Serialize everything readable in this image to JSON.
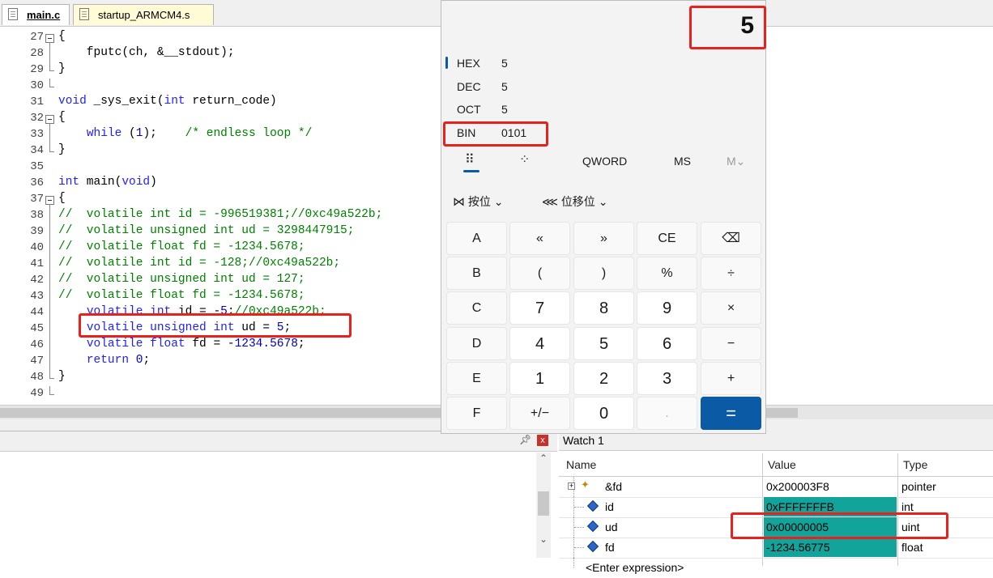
{
  "editor": {
    "tabs": [
      {
        "label": "main.c",
        "active": true
      },
      {
        "label": "startup_ARMCM4.s",
        "active": false
      }
    ],
    "lines": [
      {
        "n": "27",
        "t": "{",
        "parts": [
          [
            "",
            "{"
          ]
        ]
      },
      {
        "n": "28",
        "parts": [
          [
            "",
            "    fputc(ch, &__stdout);"
          ]
        ]
      },
      {
        "n": "29",
        "parts": [
          [
            "",
            "}"
          ]
        ]
      },
      {
        "n": "30",
        "parts": []
      },
      {
        "n": "31",
        "parts": [
          [
            "kw",
            "void"
          ],
          [
            "",
            " _sys_exit("
          ],
          [
            "kw",
            "int"
          ],
          [
            "",
            " return_code)"
          ]
        ]
      },
      {
        "n": "32",
        "parts": [
          [
            "",
            "{"
          ]
        ]
      },
      {
        "n": "33",
        "parts": [
          [
            "",
            "    "
          ],
          [
            "kw",
            "while"
          ],
          [
            "",
            " ("
          ],
          [
            "num",
            "1"
          ],
          [
            "",
            ");    "
          ],
          [
            "cm",
            "/* endless loop */"
          ]
        ]
      },
      {
        "n": "34",
        "parts": [
          [
            "",
            "}"
          ]
        ]
      },
      {
        "n": "35",
        "parts": []
      },
      {
        "n": "36",
        "parts": [
          [
            "kw",
            "int"
          ],
          [
            "",
            " main("
          ],
          [
            "kw",
            "void"
          ],
          [
            "",
            ")"
          ]
        ]
      },
      {
        "n": "37",
        "parts": [
          [
            "",
            "{"
          ]
        ]
      },
      {
        "n": "38",
        "parts": [
          [
            "cm",
            "//  volatile int id = -996519381;//0xc49a522b;"
          ]
        ]
      },
      {
        "n": "39",
        "parts": [
          [
            "cm",
            "//  volatile unsigned int ud = 3298447915;"
          ]
        ]
      },
      {
        "n": "40",
        "parts": [
          [
            "cm",
            "//  volatile float fd = -1234.5678;"
          ]
        ]
      },
      {
        "n": "41",
        "parts": [
          [
            "cm",
            "//  volatile int id = -128;//0xc49a522b;"
          ]
        ]
      },
      {
        "n": "42",
        "parts": [
          [
            "cm",
            "//  volatile unsigned int ud = 127;"
          ]
        ]
      },
      {
        "n": "43",
        "parts": [
          [
            "cm",
            "//  volatile float fd = -1234.5678;"
          ]
        ]
      },
      {
        "n": "44",
        "parts": [
          [
            "",
            "    "
          ],
          [
            "kw",
            "volatile"
          ],
          [
            "",
            " "
          ],
          [
            "kw",
            "int"
          ],
          [
            "",
            " id = -"
          ],
          [
            "num",
            "5"
          ],
          [
            "",
            ";"
          ],
          [
            "cm",
            "//0xc49a522b;"
          ]
        ]
      },
      {
        "n": "45",
        "parts": [
          [
            "",
            "    "
          ],
          [
            "kw",
            "volatile"
          ],
          [
            "",
            " "
          ],
          [
            "kw",
            "unsigned"
          ],
          [
            "",
            " "
          ],
          [
            "kw",
            "int"
          ],
          [
            "",
            " ud = "
          ],
          [
            "num",
            "5"
          ],
          [
            "",
            ";"
          ]
        ]
      },
      {
        "n": "46",
        "parts": [
          [
            "",
            "    "
          ],
          [
            "kw",
            "volatile"
          ],
          [
            "",
            " "
          ],
          [
            "kw",
            "float"
          ],
          [
            "",
            " fd = -"
          ],
          [
            "num",
            "1234.5678"
          ],
          [
            "",
            ";"
          ]
        ]
      },
      {
        "n": "47",
        "parts": [
          [
            "",
            "    "
          ],
          [
            "kw",
            "return"
          ],
          [
            "",
            " "
          ],
          [
            "num",
            "0"
          ],
          [
            "",
            ";"
          ]
        ]
      },
      {
        "n": "48",
        "parts": [
          [
            "",
            "}"
          ]
        ]
      },
      {
        "n": "49",
        "parts": []
      }
    ]
  },
  "calculator": {
    "display": "5",
    "radix": [
      {
        "label": "HEX",
        "value": "5"
      },
      {
        "label": "DEC",
        "value": "5"
      },
      {
        "label": "OCT",
        "value": "5"
      },
      {
        "label": "BIN",
        "value": "0101"
      }
    ],
    "keypad_icon": "⠿",
    "bitpad_icon": "⁘",
    "word_size": "QWORD",
    "ms": "MS",
    "m_dropdown": "M",
    "bitwise": "按位",
    "bitshift": "位移位",
    "keys": [
      [
        "A",
        "«",
        "»",
        "CE",
        "⌫"
      ],
      [
        "B",
        "(",
        ")",
        "%",
        "÷"
      ],
      [
        "C",
        "7",
        "8",
        "9",
        "×"
      ],
      [
        "D",
        "4",
        "5",
        "6",
        "−"
      ],
      [
        "E",
        "1",
        "2",
        "3",
        "+"
      ],
      [
        "F",
        "+/−",
        "0",
        ".",
        "="
      ]
    ]
  },
  "watch": {
    "title": "Watch 1",
    "columns": [
      "Name",
      "Value",
      "Type"
    ],
    "rows": [
      {
        "name": "&fd",
        "value": "0x200003F8",
        "type": "pointer",
        "highlight": false
      },
      {
        "name": "id",
        "value": "0xFFFFFFFB",
        "type": "int",
        "highlight": true
      },
      {
        "name": "ud",
        "value": "0x00000005",
        "type": "uint",
        "highlight": true
      },
      {
        "name": "fd",
        "value": "-1234.56775",
        "type": "float",
        "highlight": true
      }
    ],
    "enter_expression": "<Enter expression>"
  },
  "panel_left": {
    "pin_icon": "pin-icon",
    "close_label": "x"
  },
  "colors": {
    "annotation_red": "#e8211d",
    "calc_accent": "#0a5aa6",
    "watch_highlight": "#12a39b"
  }
}
